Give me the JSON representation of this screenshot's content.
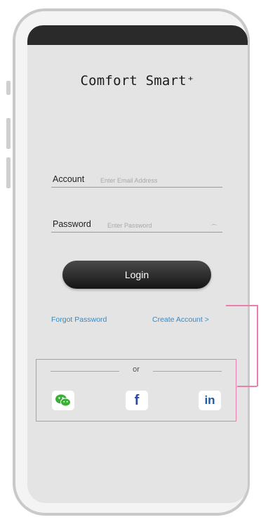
{
  "app": {
    "title": "Comfort Smart⁺"
  },
  "login_form": {
    "account_label": "Account",
    "account_placeholder": "Enter Email Address",
    "password_label": "Password",
    "password_placeholder": "Enter Password",
    "login_button": "Login"
  },
  "links": {
    "forgot_password": "Forgot Password",
    "create_account": "Create Account >"
  },
  "social": {
    "or_label": "or",
    "providers": [
      "wechat-icon",
      "facebook-icon",
      "linkedin-icon"
    ],
    "facebook_glyph": "f",
    "linkedin_glyph": "in"
  },
  "colors": {
    "accent_link": "#2f8ccc",
    "highlight": "#ea7fae",
    "wechat": "#3aae36",
    "facebook": "#2b4aa8",
    "linkedin": "#1c5aa5"
  }
}
